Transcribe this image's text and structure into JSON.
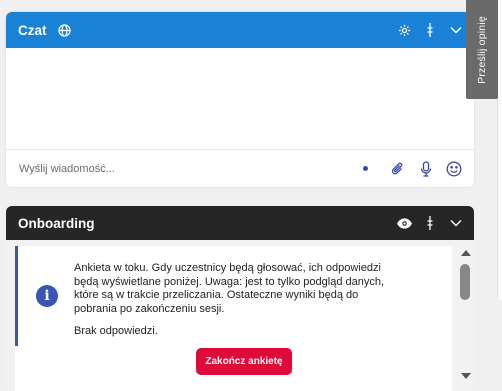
{
  "chat": {
    "title": "Czat",
    "input_placeholder": "Wyślij wiadomość..."
  },
  "onboarding": {
    "title": "Onboarding",
    "message": "Ankieta w toku. Gdy uczestnicy będą głosować, ich odpowiedzi będą wyświetlane poniżej. Uwaga: jest to tylko podgląd danych, które są w trakcie przeliczania. Ostateczne wyniki będą do pobrania po zakończeniu sesji.",
    "no_responses": "Brak odpowiedzi.",
    "end_button": "Zakończ ankietę"
  },
  "feedback_tab": "Prześlij opinię",
  "colors": {
    "chat_header": "#1a82d6",
    "onboarding_header": "#262626",
    "info_accent": "#3a55b4",
    "end_button": "#e00a38"
  },
  "icons": [
    "globe-icon",
    "settings-icon",
    "drag-handle-icon",
    "chevron-down-icon",
    "attachment-icon",
    "microphone-icon",
    "emoji-icon",
    "eye-icon",
    "info-icon"
  ]
}
